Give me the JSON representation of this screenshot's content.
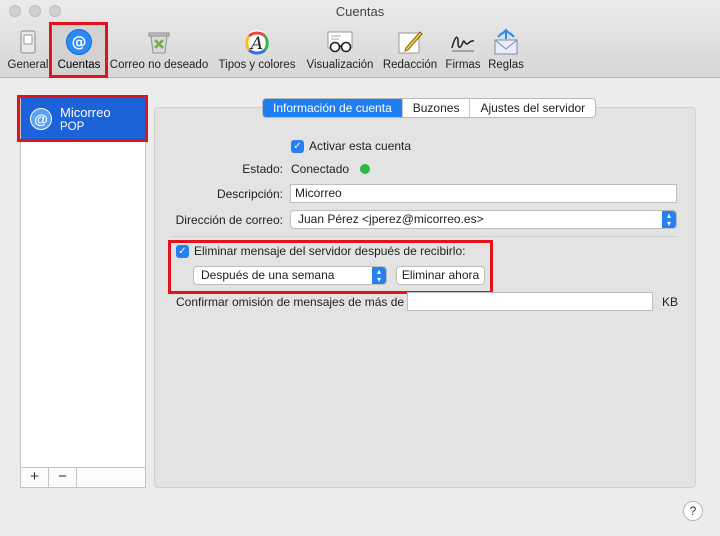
{
  "window": {
    "title": "Cuentas"
  },
  "toolbar": {
    "items": [
      {
        "label": "General",
        "icon": "switch-icon"
      },
      {
        "label": "Cuentas",
        "icon": "at-sign-icon",
        "selected": true
      },
      {
        "label": "Correo no deseado",
        "icon": "junk-trash-icon"
      },
      {
        "label": "Tipos y colores",
        "icon": "font-color-icon"
      },
      {
        "label": "Visualización",
        "icon": "glasses-icon"
      },
      {
        "label": "Redacción",
        "icon": "compose-pencil-icon"
      },
      {
        "label": "Firmas",
        "icon": "signature-icon"
      },
      {
        "label": "Reglas",
        "icon": "rules-envelope-icon"
      }
    ]
  },
  "sidebar": {
    "accounts": [
      {
        "name": "Micorreo",
        "type": "POP",
        "icon": "at-sign-icon"
      }
    ],
    "add_label": "+",
    "remove_label": "−"
  },
  "tabs": [
    {
      "label": "Información de cuenta",
      "active": true
    },
    {
      "label": "Buzones",
      "active": false
    },
    {
      "label": "Ajustes del servidor",
      "active": false
    }
  ],
  "form": {
    "enable_account": {
      "label": "Activar esta cuenta",
      "checked": true
    },
    "status": {
      "label": "Estado:",
      "value": "Conectado",
      "color": "#2bb845"
    },
    "description": {
      "label": "Descripción:",
      "value": "Micorreo"
    },
    "email_address": {
      "label": "Dirección de correo:",
      "value": "Juan Pérez <jperez@micorreo.es>"
    },
    "delete_from_server": {
      "label": "Eliminar mensaje del servidor después de recibirlo:",
      "checked": true
    },
    "delete_after": {
      "value": "Después de una semana"
    },
    "delete_now_button": "Eliminar ahora",
    "confirm_skip": {
      "label": "Confirmar omisión de mensajes de más de",
      "value": "",
      "unit": "KB"
    }
  },
  "help_label": "?",
  "colors": {
    "accent": "#1f7ef1",
    "selection": "#1c62d8",
    "highlight_box": "#e1141d"
  }
}
